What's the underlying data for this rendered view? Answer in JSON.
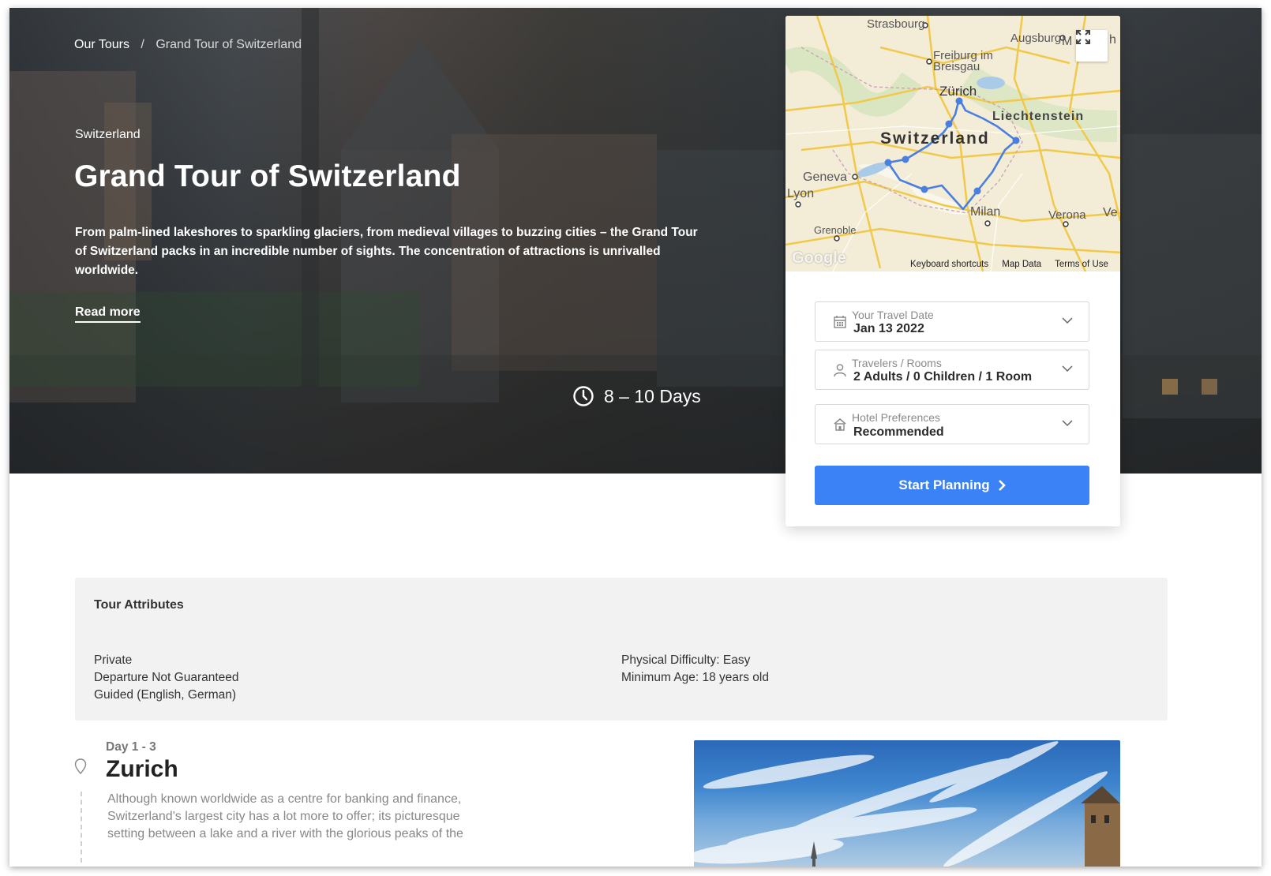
{
  "breadcrumb": {
    "root": "Our Tours",
    "separator": "/",
    "current": "Grand Tour of Switzerland"
  },
  "hero": {
    "country": "Switzerland",
    "title": "Grand Tour of Switzerland",
    "description": "From palm-lined lakeshores to sparkling glaciers, from medieval villages to buzzing cities – the Grand Tour of Switzerland packs in an incredible number of sights. The concentration of attractions is unrivalled worldwide.",
    "read_more": "Read more",
    "duration": "8 – 10 Days"
  },
  "map": {
    "labels": {
      "strasbourg": "Strasbourg",
      "augsburg": "Augsburg",
      "freiburg": "Freiburg im Breisgau",
      "zurich": "Zürich",
      "liechtenstein": "Liechtenstein",
      "switzerland": "Switzerland",
      "geneva": "Geneva",
      "lyon": "Lyon",
      "grenoble": "Grenoble",
      "milan": "Milan",
      "verona": "Verona",
      "ve": "Ve",
      "m": "M",
      "h": "h"
    },
    "google": "Google",
    "footer": {
      "shortcuts": "Keyboard shortcuts",
      "data": "Map Data",
      "terms": "Terms of Use"
    }
  },
  "booking": {
    "travel_date": {
      "label": "Your Travel Date",
      "value": "Jan 13 2022"
    },
    "travelers": {
      "label": "Travelers / Rooms",
      "value": "2 Adults / 0 Children / 1 Room"
    },
    "hotel": {
      "label": "Hotel Preferences",
      "value": "Recommended"
    },
    "start_button": "Start Planning"
  },
  "attributes": {
    "title": "Tour Attributes",
    "left": [
      "Private",
      "Departure Not Guaranteed",
      "Guided (English, German)"
    ],
    "right": [
      "Physical Difficulty: Easy",
      "Minimum Age: 18 years old"
    ]
  },
  "day": {
    "range": "Day 1 - 3",
    "city": "Zurich",
    "description": "Although known worldwide as a centre for banking and finance, Switzerland's largest city has a lot more to offer; its picturesque setting between a lake and a river with the glorious peaks of the"
  },
  "colors": {
    "primary": "#3b82f6",
    "route": "#4a7fe0",
    "attr_bg": "#f2f2f2"
  }
}
